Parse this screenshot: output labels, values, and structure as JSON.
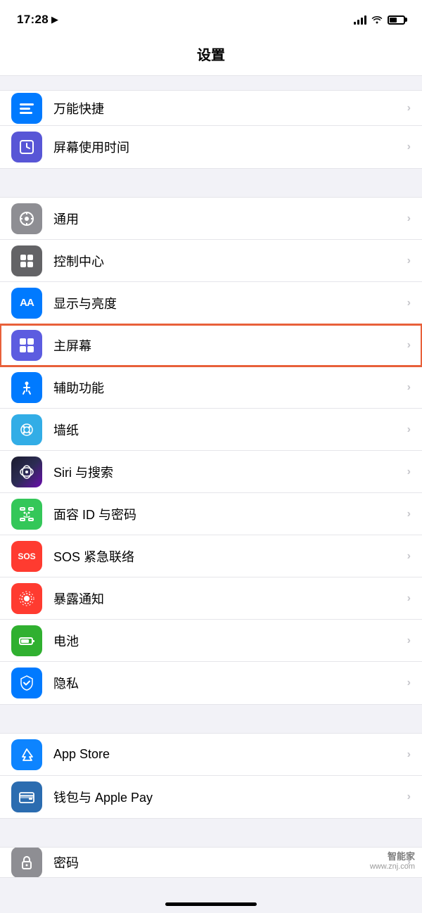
{
  "statusBar": {
    "time": "17:28",
    "location": "▶"
  },
  "pageTitle": "设置",
  "sections": [
    {
      "id": "section1",
      "rows": [
        {
          "id": "row-shortcut",
          "label": "万能快捷",
          "iconBg": "icon-blue",
          "iconSymbol": "⚡",
          "partial": true
        },
        {
          "id": "row-screentime",
          "label": "屏幕使用时间",
          "iconBg": "icon-purple",
          "iconSymbol": "⏱"
        }
      ]
    },
    {
      "id": "section2",
      "rows": [
        {
          "id": "row-general",
          "label": "通用",
          "iconBg": "icon-gray",
          "iconSymbol": "⚙"
        },
        {
          "id": "row-controlcenter",
          "label": "控制中心",
          "iconBg": "icon-gray2",
          "iconSymbol": "🎛"
        },
        {
          "id": "row-display",
          "label": "显示与亮度",
          "iconBg": "icon-blue",
          "iconSymbol": "AA"
        },
        {
          "id": "row-homescreen",
          "label": "主屏幕",
          "iconBg": "icon-indigo",
          "iconSymbol": "⠿",
          "highlighted": true
        },
        {
          "id": "row-accessibility",
          "label": "辅助功能",
          "iconBg": "icon-blue",
          "iconSymbol": "♿"
        },
        {
          "id": "row-wallpaper",
          "label": "墙纸",
          "iconBg": "icon-teal",
          "iconSymbol": "✿"
        },
        {
          "id": "row-siri",
          "label": "Siri 与搜索",
          "iconBg": "icon-indigo",
          "iconSymbol": "◎"
        },
        {
          "id": "row-faceid",
          "label": "面容 ID 与密码",
          "iconBg": "icon-green",
          "iconSymbol": "☺"
        },
        {
          "id": "row-sos",
          "label": "SOS 紧急联络",
          "iconBg": "icon-red",
          "iconSymbol": "SOS"
        },
        {
          "id": "row-exposure",
          "label": "暴露通知",
          "iconBg": "icon-red",
          "iconSymbol": "◉"
        },
        {
          "id": "row-battery",
          "label": "电池",
          "iconBg": "icon-darkgreen",
          "iconSymbol": "▬"
        },
        {
          "id": "row-privacy",
          "label": "隐私",
          "iconBg": "icon-blue",
          "iconSymbol": "✋"
        }
      ]
    },
    {
      "id": "section3",
      "rows": [
        {
          "id": "row-appstore",
          "label": "App Store",
          "iconBg": "icon-appstore",
          "iconSymbol": "A"
        },
        {
          "id": "row-wallet",
          "label": "钱包与 Apple Pay",
          "iconBg": "icon-wallet",
          "iconSymbol": "💳"
        }
      ]
    },
    {
      "id": "section4",
      "rows": [
        {
          "id": "row-password",
          "label": "密码",
          "iconBg": "icon-gray",
          "iconSymbol": "🔑",
          "partial": true
        }
      ]
    }
  ],
  "watermark": {
    "line1": "智能家",
    "line2": "www.znj.com"
  },
  "chevron": "›"
}
